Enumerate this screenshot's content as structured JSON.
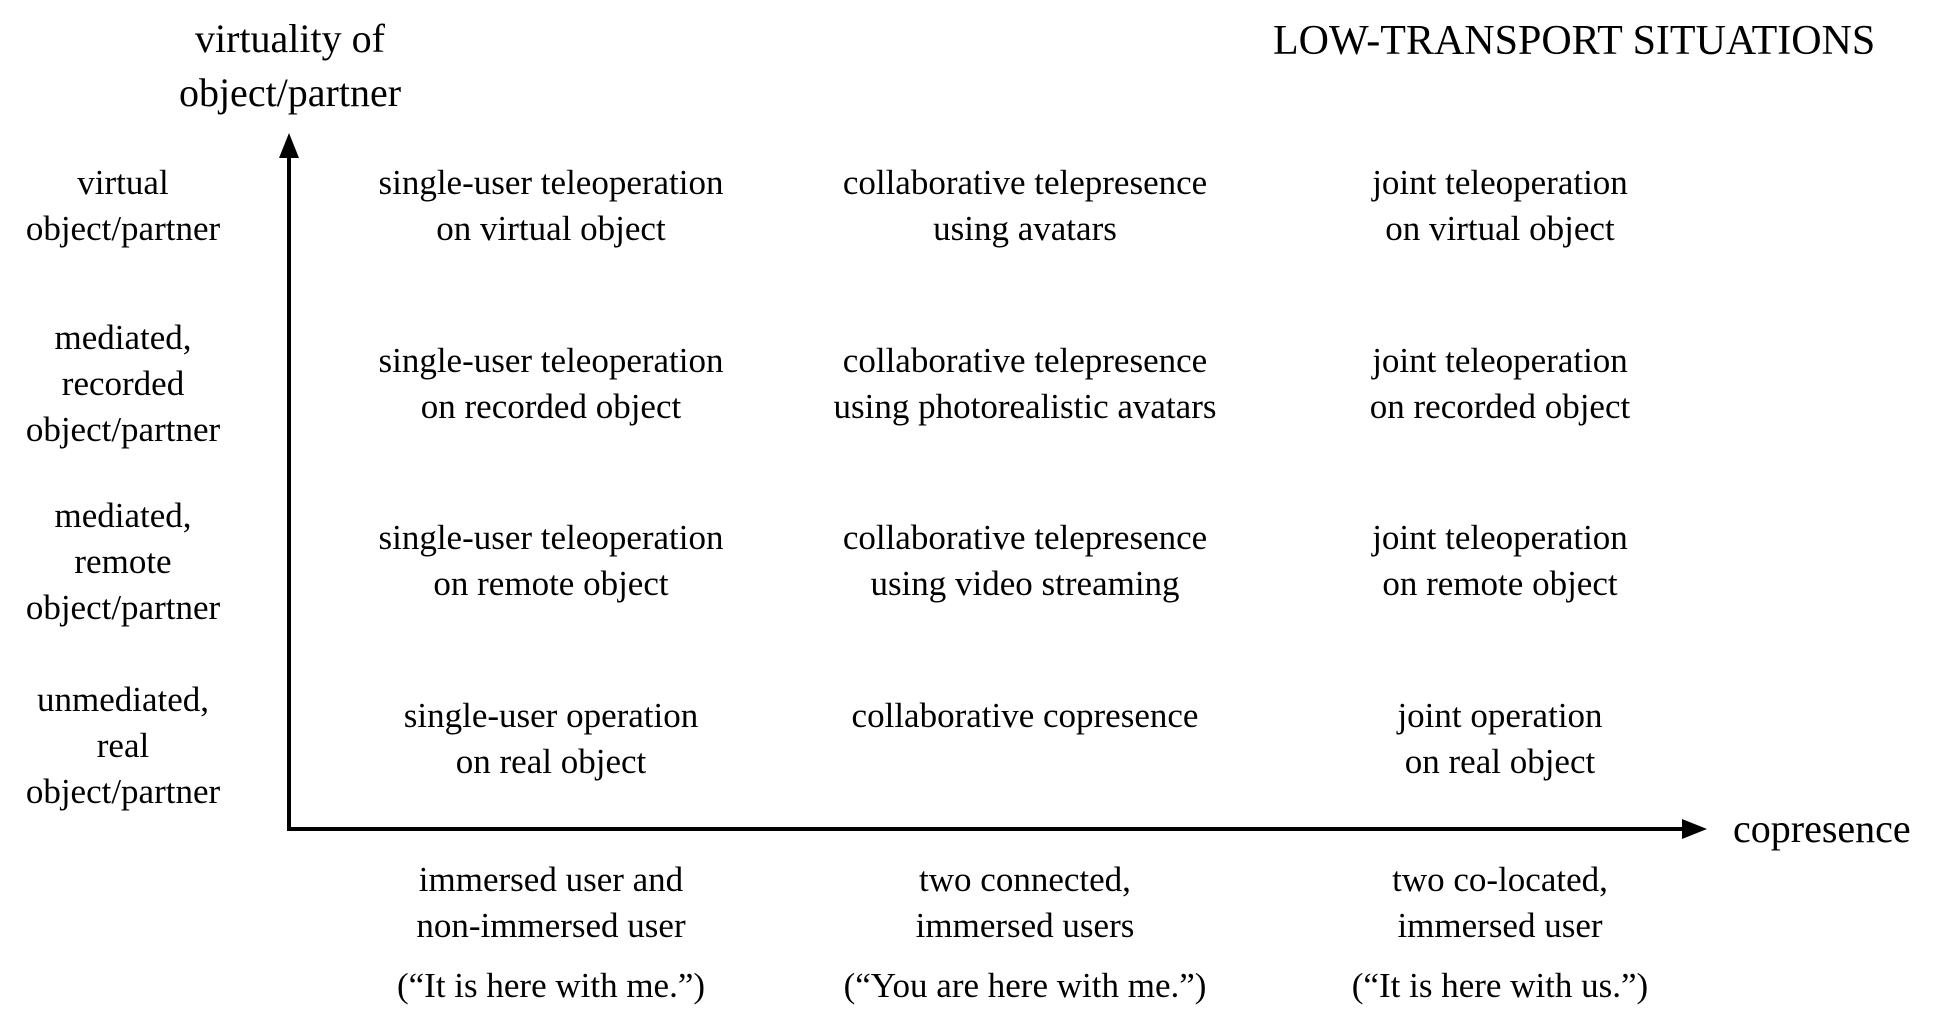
{
  "title": "LOW-TRANSPORT SITUATIONS",
  "y_axis": {
    "label_lines": [
      "virtuality of",
      "object/partner"
    ],
    "levels": [
      {
        "lines": [
          "virtual",
          "object/partner"
        ]
      },
      {
        "lines": [
          "mediated,",
          "recorded",
          "object/partner"
        ]
      },
      {
        "lines": [
          "mediated,",
          "remote",
          "object/partner"
        ]
      },
      {
        "lines": [
          "unmediated,",
          "real",
          "object/partner"
        ]
      }
    ]
  },
  "x_axis": {
    "label": "copresence",
    "categories": [
      {
        "lines": [
          "immersed user and",
          "non-immersed user"
        ],
        "quote": "(“It is here with me.”)"
      },
      {
        "lines": [
          "two connected,",
          "immersed users"
        ],
        "quote": "(“You are here with me.”)"
      },
      {
        "lines": [
          "two co-located,",
          "immersed user"
        ],
        "quote": "(“It is here with us.”)"
      }
    ]
  },
  "grid": [
    [
      {
        "lines": [
          "single-user teleoperation",
          "on virtual object"
        ]
      },
      {
        "lines": [
          "collaborative telepresence",
          "using avatars"
        ]
      },
      {
        "lines": [
          "joint teleoperation",
          "on virtual object"
        ]
      }
    ],
    [
      {
        "lines": [
          "single-user teleoperation",
          "on recorded object"
        ]
      },
      {
        "lines": [
          "collaborative telepresence",
          "using photorealistic avatars"
        ]
      },
      {
        "lines": [
          "joint teleoperation",
          "on recorded object"
        ]
      }
    ],
    [
      {
        "lines": [
          "single-user teleoperation",
          "on remote object"
        ]
      },
      {
        "lines": [
          "collaborative telepresence",
          "using video streaming"
        ]
      },
      {
        "lines": [
          "joint teleoperation",
          "on remote object"
        ]
      }
    ],
    [
      {
        "lines": [
          "single-user operation",
          "on real object"
        ]
      },
      {
        "lines": [
          "collaborative copresence"
        ]
      },
      {
        "lines": [
          "joint operation",
          "on real object"
        ]
      }
    ]
  ]
}
